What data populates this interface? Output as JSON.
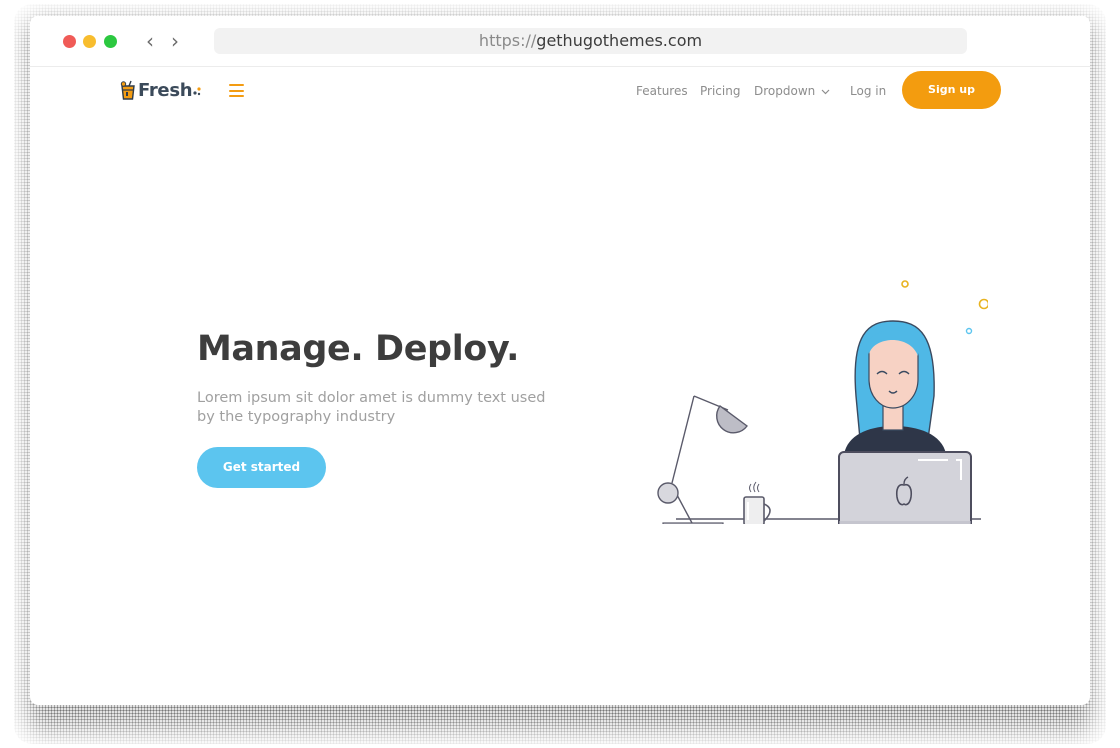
{
  "browser": {
    "url_protocol": "https://",
    "url_host": "gethugothemes.com"
  },
  "site": {
    "logo_text_main": "Fresh",
    "nav": {
      "features": "Features",
      "pricing": "Pricing",
      "dropdown": "Dropdown",
      "login": "Log in",
      "signup": "Sign up"
    }
  },
  "hero": {
    "title": "Manage. Deploy.",
    "subtitle": "Lorem ipsum sit dolor amet is dummy text used by the typography industry",
    "cta": "Get started"
  },
  "colors": {
    "accent_orange": "#f39c12",
    "cta_blue": "#5cc5ef",
    "hair_blue": "#4fb8e6"
  },
  "icons": [
    "back-arrow-icon",
    "forward-arrow-icon",
    "hamburger-menu-icon",
    "chevron-down-icon",
    "apple-logo-icon"
  ]
}
